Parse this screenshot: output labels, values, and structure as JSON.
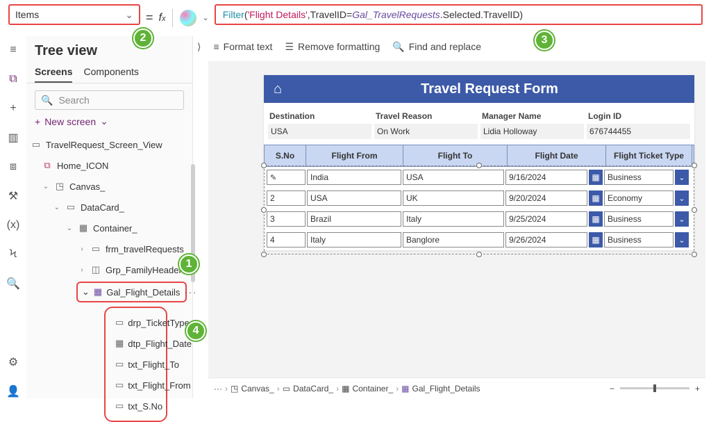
{
  "property_selector": {
    "value": "Items"
  },
  "formula": {
    "fn": "Filter",
    "open": "(",
    "arg1": "'Flight Details'",
    "comma1": ",",
    "field": "TravelID",
    "eq": "=",
    "var": "Gal_TravelRequests",
    "rest": ".Selected.TravelID)"
  },
  "fmtbar": {
    "format": "Format text",
    "remove": "Remove formatting",
    "find": "Find and replace"
  },
  "tree": {
    "title": "Tree view",
    "tabs": {
      "screens": "Screens",
      "components": "Components"
    },
    "search_placeholder": "Search",
    "new_screen": "New screen",
    "root": "TravelRequest_Screen_View",
    "home": "Home_ICON",
    "canvas": "Canvas_",
    "datacard": "DataCard_",
    "container": "Container_",
    "frm": "frm_travelRequests",
    "grp": "Grp_FamilyHeaders",
    "gal": "Gal_Flight_Details",
    "drp": "drp_TicketType",
    "dtp": "dtp_Flight_Date",
    "txtto": "txt_Flight_To",
    "txtfrom": "txt_Flight_From",
    "txtsno": "txt_S.No"
  },
  "form": {
    "title": "Travel Request Form",
    "fields": {
      "destination": {
        "label": "Destination",
        "value": "USA"
      },
      "reason": {
        "label": "Travel Reason",
        "value": "On Work"
      },
      "manager": {
        "label": "Manager Name",
        "value": "Lidia Holloway"
      },
      "login": {
        "label": "Login ID",
        "value": "676744455"
      }
    },
    "headers": {
      "sno": "S.No",
      "from": "Flight From",
      "to": "Flight To",
      "date": "Flight Date",
      "type": "Flight Ticket Type"
    },
    "rows": [
      {
        "sno": "",
        "from": "India",
        "to": "USA",
        "date": "9/16/2024",
        "type": "Business"
      },
      {
        "sno": "2",
        "from": "USA",
        "to": "UK",
        "date": "9/20/2024",
        "type": "Economy"
      },
      {
        "sno": "3",
        "from": "Brazil",
        "to": "Italy",
        "date": "9/25/2024",
        "type": "Business"
      },
      {
        "sno": "4",
        "from": "Italy",
        "to": "Banglore",
        "date": "9/26/2024",
        "type": "Business"
      }
    ]
  },
  "breadcrumb": {
    "canvas": "Canvas_",
    "datacard": "DataCard_",
    "container": "Container_",
    "gal": "Gal_Flight_Details"
  },
  "badges": {
    "b1": "1",
    "b2": "2",
    "b3": "3",
    "b4": "4"
  }
}
